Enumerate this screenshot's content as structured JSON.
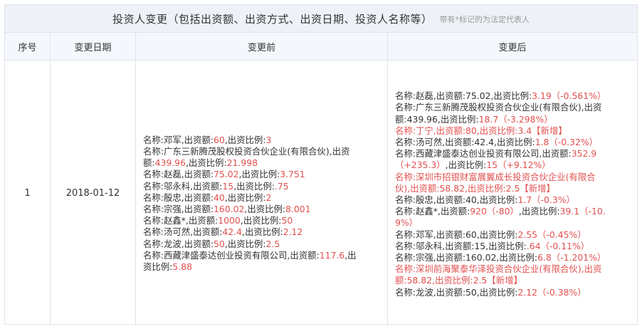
{
  "title": "投资人变更（包括出资额、出资方式、出资日期、投资人名称等）",
  "note": "带有*标记的为法定代表人",
  "headers": {
    "seq": "序号",
    "date": "变更日期",
    "before": "变更前",
    "after": "变更后"
  },
  "row": {
    "seq": "1",
    "date": "2018-01-12"
  },
  "before_lines": [
    [
      {
        "t": "名称:邓军,出资额:"
      },
      {
        "t": "60",
        "r": 1
      },
      {
        "t": ",出资比例:"
      },
      {
        "t": "3",
        "r": 1
      }
    ],
    [
      {
        "t": "名称:广东三新腾茂股权投资合伙企业(有限合伙),出资"
      }
    ],
    [
      {
        "t": "额:"
      },
      {
        "t": "439.96",
        "r": 1
      },
      {
        "t": ",出资比例:"
      },
      {
        "t": "21.998",
        "r": 1
      }
    ],
    [
      {
        "t": "名称:赵磊,出资额:"
      },
      {
        "t": "75.02",
        "r": 1
      },
      {
        "t": ",出资比例:"
      },
      {
        "t": "3.751",
        "r": 1
      }
    ],
    [
      {
        "t": "名称:邬永科,出资额:"
      },
      {
        "t": "15",
        "r": 1
      },
      {
        "t": ",出资比例:"
      },
      {
        "t": ".75",
        "r": 1
      }
    ],
    [
      {
        "t": "名称:殷忠,出资额:"
      },
      {
        "t": "40",
        "r": 1
      },
      {
        "t": ",出资比例:"
      },
      {
        "t": "2",
        "r": 1
      }
    ],
    [
      {
        "t": "名称:宗强,出资额:"
      },
      {
        "t": "160.02",
        "r": 1
      },
      {
        "t": ",出资比例:"
      },
      {
        "t": "8.001",
        "r": 1
      }
    ],
    [
      {
        "t": "名称:赵鑫*,出资额:"
      },
      {
        "t": "1000",
        "r": 1
      },
      {
        "t": ",出资比例:"
      },
      {
        "t": "50",
        "r": 1
      }
    ],
    [
      {
        "t": "名称:汤可然,出资额:"
      },
      {
        "t": "42.4",
        "r": 1
      },
      {
        "t": ",出资比例:"
      },
      {
        "t": "2.12",
        "r": 1
      }
    ],
    [
      {
        "t": "名称:龙波,出资额:"
      },
      {
        "t": "50",
        "r": 1
      },
      {
        "t": ",出资比例:"
      },
      {
        "t": "2.5",
        "r": 1
      }
    ],
    [
      {
        "t": "名称:西藏津盛泰达创业投资有限公司,出资额:"
      },
      {
        "t": "117.6",
        "r": 1
      },
      {
        "t": ",出"
      }
    ],
    [
      {
        "t": "资比例:"
      },
      {
        "t": "5.88",
        "r": 1
      }
    ]
  ],
  "after_lines": [
    [
      {
        "t": "名称:赵磊,出资额:75.02,出资比例:"
      },
      {
        "t": "3.19（-0.561%）",
        "r": 1
      }
    ],
    [
      {
        "t": "名称:广东三新腾茂股权投资合伙企业(有限合伙),出资"
      }
    ],
    [
      {
        "t": "额:439.96,出资比例:"
      },
      {
        "t": "18.7（-3.298%）",
        "r": 1
      }
    ],
    [
      {
        "t": "名称:丁宁,出资额:80,出资比例:3.4【新增】",
        "r": 1
      }
    ],
    [
      {
        "t": "名称:汤可然,出资额:42.4,出资比例:"
      },
      {
        "t": "1.8（-0.32%）",
        "r": 1
      }
    ],
    [
      {
        "t": "名称:西藏津盛泰达创业投资有限公司,出资额:"
      },
      {
        "t": "352.9",
        "r": 1
      }
    ],
    [
      {
        "t": "（+235.3）",
        "r": 1
      },
      {
        "t": ",出资比例:"
      },
      {
        "t": "15（+9.12%）",
        "r": 1
      }
    ],
    [
      {
        "t": "名称:深圳市招银财富展翼成长投资合伙企业(有限合",
        "r": 1
      }
    ],
    [
      {
        "t": "伙),出资额:58.82,出资比例:2.5【新增】",
        "r": 1
      }
    ],
    [
      {
        "t": "名称:殷忠,出资额:40,出资比例:"
      },
      {
        "t": "1.7（-0.3%）",
        "r": 1
      }
    ],
    [
      {
        "t": "名称:赵鑫*,出资额:"
      },
      {
        "t": "920（-80）",
        "r": 1
      },
      {
        "t": ",出资比例:"
      },
      {
        "t": "39.1（-10.",
        "r": 1
      }
    ],
    [
      {
        "t": "9%）",
        "r": 1
      }
    ],
    [
      {
        "t": "名称:邓军,出资额:60,出资比例:"
      },
      {
        "t": "2.55（-0.45%）",
        "r": 1
      }
    ],
    [
      {
        "t": "名称:邬永科,出资额:15,出资比例:"
      },
      {
        "t": ".64（-0.11%）",
        "r": 1
      }
    ],
    [
      {
        "t": "名称:宗强,出资额:160.02,出资比例:"
      },
      {
        "t": "6.8（-1.201%）",
        "r": 1
      }
    ],
    [
      {
        "t": "名称:深圳前海聚泰华泽投资合伙企业(有限合伙),出资",
        "r": 1
      }
    ],
    [
      {
        "t": "额:58.82,出资比例:2.5【新增】",
        "r": 1
      }
    ],
    [
      {
        "t": "名称:龙波,出资额:50,出资比例:"
      },
      {
        "t": "2.12（-0.38%）",
        "r": 1
      }
    ]
  ],
  "colors": {
    "highlight": "#e0514f",
    "header_bg": "#eef2f8",
    "border": "#dfe3ea"
  }
}
